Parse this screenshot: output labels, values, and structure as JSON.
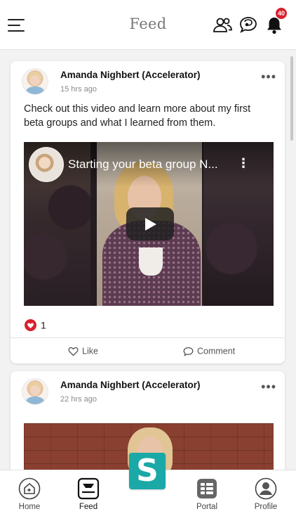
{
  "header": {
    "title": "Feed",
    "notification_count": "40",
    "menu_icon": "hamburger-menu-icon",
    "people_icon": "people-icon",
    "chat_icon": "chat-bubbles-icon",
    "bell_icon": "bell-icon"
  },
  "posts": [
    {
      "author": "Amanda Nighbert (Accelerator)",
      "time": "15 hrs ago",
      "text": "Check out this video and learn more about my first beta groups and what I learned from them.",
      "video_title": "Starting your beta group N...",
      "like_count": "1",
      "like_label": "Like",
      "comment_label": "Comment"
    },
    {
      "author": "Amanda Nighbert (Accelerator)",
      "time": "22 hrs ago"
    }
  ],
  "bottom_nav": {
    "home": "Home",
    "feed": "Feed",
    "portal": "Portal",
    "profile": "Profile",
    "logo_letter": "S"
  },
  "colors": {
    "accent": "#1aa9a6",
    "badge": "#d9202c",
    "like_heart": "#d9202c"
  }
}
